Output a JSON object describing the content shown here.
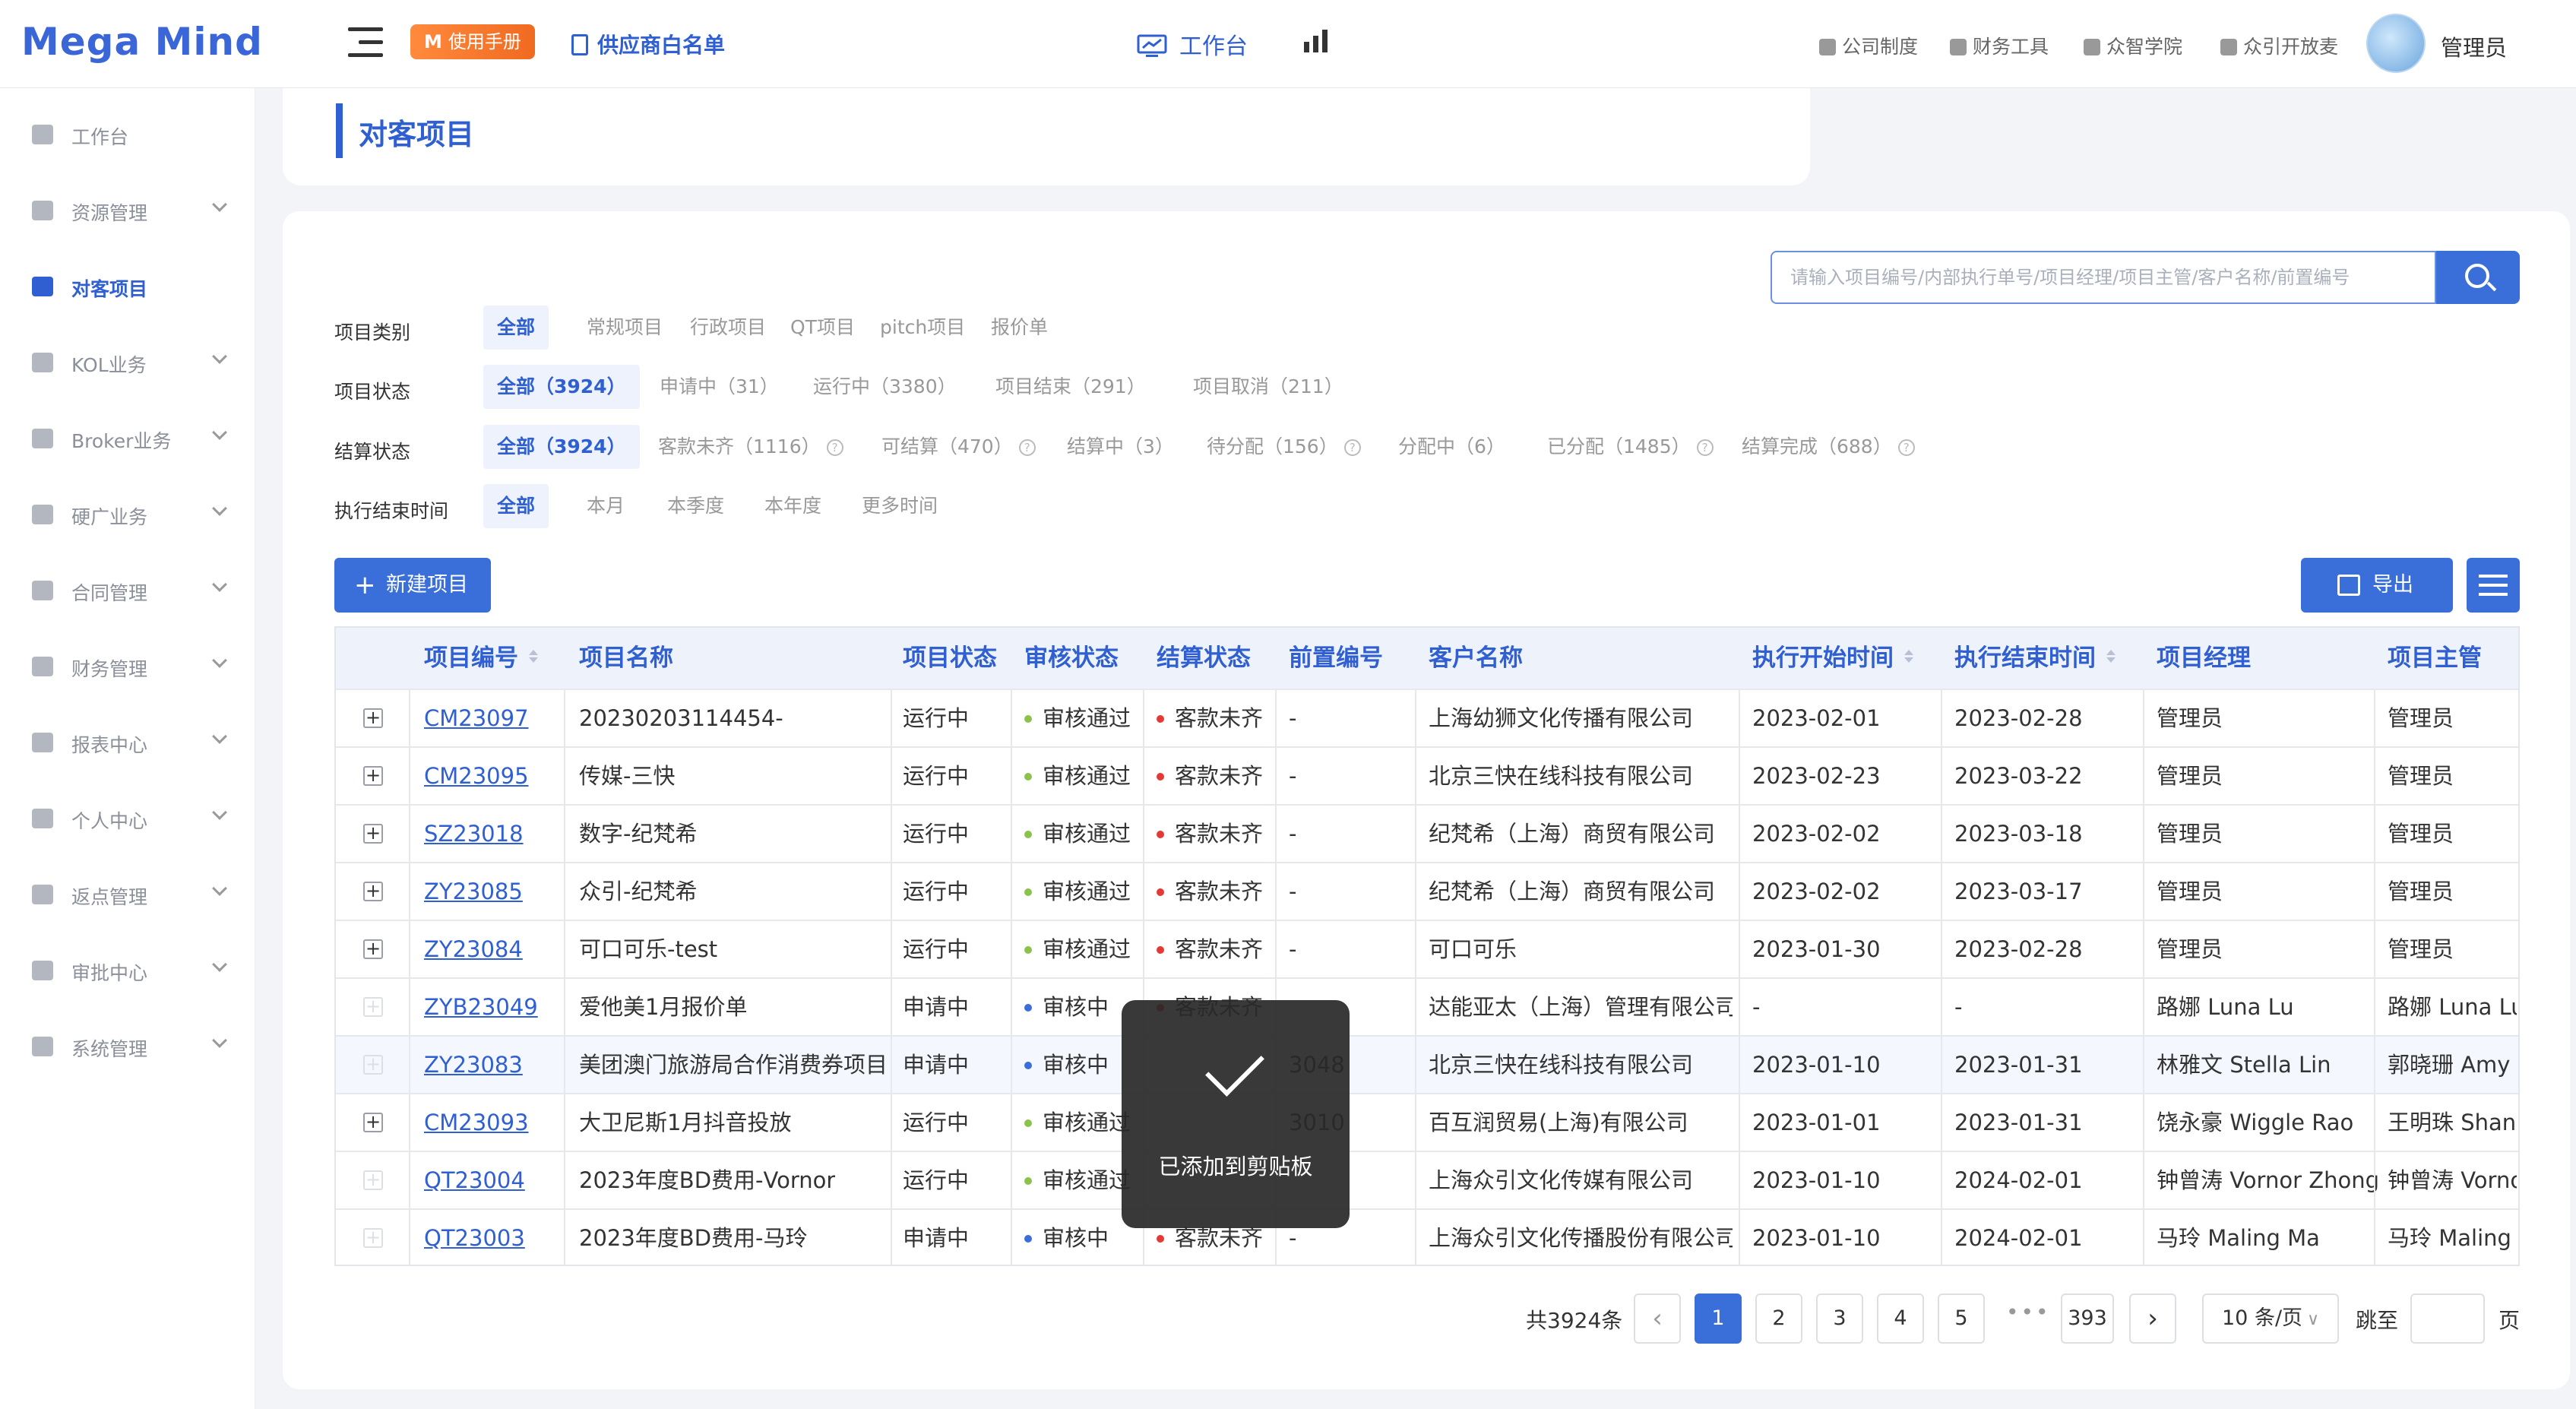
{
  "app": {
    "logo": "Mega Mind"
  },
  "header": {
    "manual_badge": "M",
    "manual_label": "使用手册",
    "whitelist_label": "供应商白名单",
    "nav_work": "工作台",
    "nav_observe": "观测台",
    "links": [
      "公司制度",
      "财务工具",
      "众智学院",
      "众引开放麦"
    ],
    "user": "管理员"
  },
  "sidebar": {
    "items": [
      {
        "label": "工作台",
        "icon": "monitor-icon",
        "expandable": false
      },
      {
        "label": "资源管理",
        "icon": "grid-icon",
        "expandable": true
      },
      {
        "label": "对客项目",
        "icon": "list-icon",
        "expandable": false,
        "active": true
      },
      {
        "label": "KOL业务",
        "icon": "clipboard-icon",
        "expandable": true
      },
      {
        "label": "Broker业务",
        "icon": "building-icon",
        "expandable": true
      },
      {
        "label": "硬广业务",
        "icon": "ad-icon",
        "expandable": true
      },
      {
        "label": "合同管理",
        "icon": "document-icon",
        "expandable": true
      },
      {
        "label": "财务管理",
        "icon": "coin-icon",
        "expandable": true
      },
      {
        "label": "报表中心",
        "icon": "chart-icon",
        "expandable": true
      },
      {
        "label": "个人中心",
        "icon": "person-icon",
        "expandable": true
      },
      {
        "label": "返点管理",
        "icon": "rebate-icon",
        "expandable": true
      },
      {
        "label": "审批中心",
        "icon": "approve-icon",
        "expandable": true
      },
      {
        "label": "系统管理",
        "icon": "gear-icon",
        "expandable": true
      }
    ]
  },
  "page": {
    "title": "对客项目"
  },
  "search": {
    "placeholder": "请输入项目编号/内部执行单号/项目经理/项目主管/客户名称/前置编号"
  },
  "filters": [
    {
      "label": "项目类别",
      "options": [
        "全部",
        "常规项目",
        "行政项目",
        "QT项目",
        "pitch项目",
        "报价单"
      ],
      "selected": 0
    },
    {
      "label": "项目状态",
      "options": [
        "全部（3924）",
        "申请中（31）",
        "运行中（3380）",
        "项目结束（291）",
        "项目取消（211）"
      ],
      "selected": 0
    },
    {
      "label": "结算状态",
      "options": [
        "全部（3924）",
        "客款未齐（1116）",
        "可结算（470）",
        "结算中（3）",
        "待分配（156）",
        "分配中（6）",
        "已分配（1485）",
        "结算完成（688）"
      ],
      "selected": 0
    },
    {
      "label": "执行结束时间",
      "options": [
        "全部",
        "本月",
        "本季度",
        "本年度",
        "更多时间"
      ],
      "selected": 0
    }
  ],
  "actions": {
    "new_project": "新建项目",
    "export": "导出"
  },
  "table": {
    "columns": [
      "项目编号",
      "项目名称",
      "项目状态",
      "审核状态",
      "结算状态",
      "前置编号",
      "客户名称",
      "执行开始时间",
      "执行结束时间",
      "项目经理",
      "项目主管"
    ],
    "rows": [
      {
        "id": "CM23097",
        "name": "20230203114454-",
        "status": "运行中",
        "audit": "审核通过",
        "settle": "客款未齐",
        "pre": "-",
        "client": "上海幼狮文化传播有限公司",
        "start": "2023-02-01",
        "end": "2023-02-28",
        "manager": "管理员",
        "supervisor": "管理员",
        "expand_enabled": true
      },
      {
        "id": "CM23095",
        "name": "传媒-三快",
        "status": "运行中",
        "audit": "审核通过",
        "settle": "客款未齐",
        "pre": "-",
        "client": "北京三快在线科技有限公司",
        "start": "2023-02-23",
        "end": "2023-03-22",
        "manager": "管理员",
        "supervisor": "管理员",
        "expand_enabled": true
      },
      {
        "id": "SZ23018",
        "name": "数字-纪梵希",
        "status": "运行中",
        "audit": "审核通过",
        "settle": "客款未齐",
        "pre": "-",
        "client": "纪梵希（上海）商贸有限公司",
        "start": "2023-02-02",
        "end": "2023-03-18",
        "manager": "管理员",
        "supervisor": "管理员",
        "expand_enabled": true
      },
      {
        "id": "ZY23085",
        "name": "众引-纪梵希",
        "status": "运行中",
        "audit": "审核通过",
        "settle": "客款未齐",
        "pre": "-",
        "client": "纪梵希（上海）商贸有限公司",
        "start": "2023-02-02",
        "end": "2023-03-17",
        "manager": "管理员",
        "supervisor": "管理员",
        "expand_enabled": true
      },
      {
        "id": "ZY23084",
        "name": "可口可乐-test",
        "status": "运行中",
        "audit": "审核通过",
        "settle": "客款未齐",
        "pre": "-",
        "client": "可口可乐",
        "start": "2023-01-30",
        "end": "2023-02-28",
        "manager": "管理员",
        "supervisor": "管理员",
        "expand_enabled": true
      },
      {
        "id": "ZYB23049",
        "name": "爱他美1月报价单",
        "status": "申请中",
        "audit": "审核中",
        "settle": "客款未齐",
        "pre": "",
        "client": "达能亚太（上海）管理有限公司",
        "start": "-",
        "end": "-",
        "manager": "路娜 Luna Lu",
        "supervisor": "路娜 Luna Lu",
        "expand_enabled": false
      },
      {
        "id": "ZY23083",
        "name": "美团澳门旅游局合作消费券项目",
        "status": "申请中",
        "audit": "审核中",
        "settle": "",
        "pre": "3048",
        "client": "北京三快在线科技有限公司",
        "start": "2023-01-10",
        "end": "2023-01-31",
        "manager": "林雅文 Stella Lin",
        "supervisor": "郭晓珊 Amy G",
        "expand_enabled": false,
        "highlight": true
      },
      {
        "id": "CM23093",
        "name": "大卫尼斯1月抖音投放",
        "status": "运行中",
        "audit": "审核通过",
        "settle": "",
        "pre": "3010",
        "client": "百互润贸易(上海)有限公司",
        "start": "2023-01-01",
        "end": "2023-01-31",
        "manager": "饶永豪 Wiggle Rao",
        "supervisor": "王明珠 Shane",
        "expand_enabled": true
      },
      {
        "id": "QT23004",
        "name": "2023年度BD费用-Vornor",
        "status": "运行中",
        "audit": "审核通过",
        "settle": "",
        "pre": "",
        "client": "上海众引文化传媒有限公司",
        "start": "2023-01-10",
        "end": "2024-02-01",
        "manager": "钟曾涛 Vornor Zhong",
        "supervisor": "钟曾涛 Vornor",
        "expand_enabled": false
      },
      {
        "id": "QT23003",
        "name": "2023年度BD费用-马玲",
        "status": "申请中",
        "audit": "审核中",
        "settle": "客款未齐",
        "pre": "-",
        "client": "上海众引文化传播股份有限公司",
        "start": "2023-01-10",
        "end": "2024-02-01",
        "manager": "马玲 Maling Ma",
        "supervisor": "马玲 Maling M",
        "expand_enabled": false
      }
    ]
  },
  "pagination": {
    "total": "共3924条",
    "pages": [
      "1",
      "2",
      "3",
      "4",
      "5"
    ],
    "ellipsis": "•••",
    "last": "393",
    "current": "1",
    "page_size": "10 条/页",
    "jump_label": "跳至",
    "page_unit": "页"
  },
  "toast": {
    "message": "已添加到剪贴板"
  },
  "colors": {
    "primary": "#3a6ed8",
    "audit_ok": "#8bc34a",
    "audit_pending": "#3a6ed8",
    "settle_dot": "#e53935"
  }
}
